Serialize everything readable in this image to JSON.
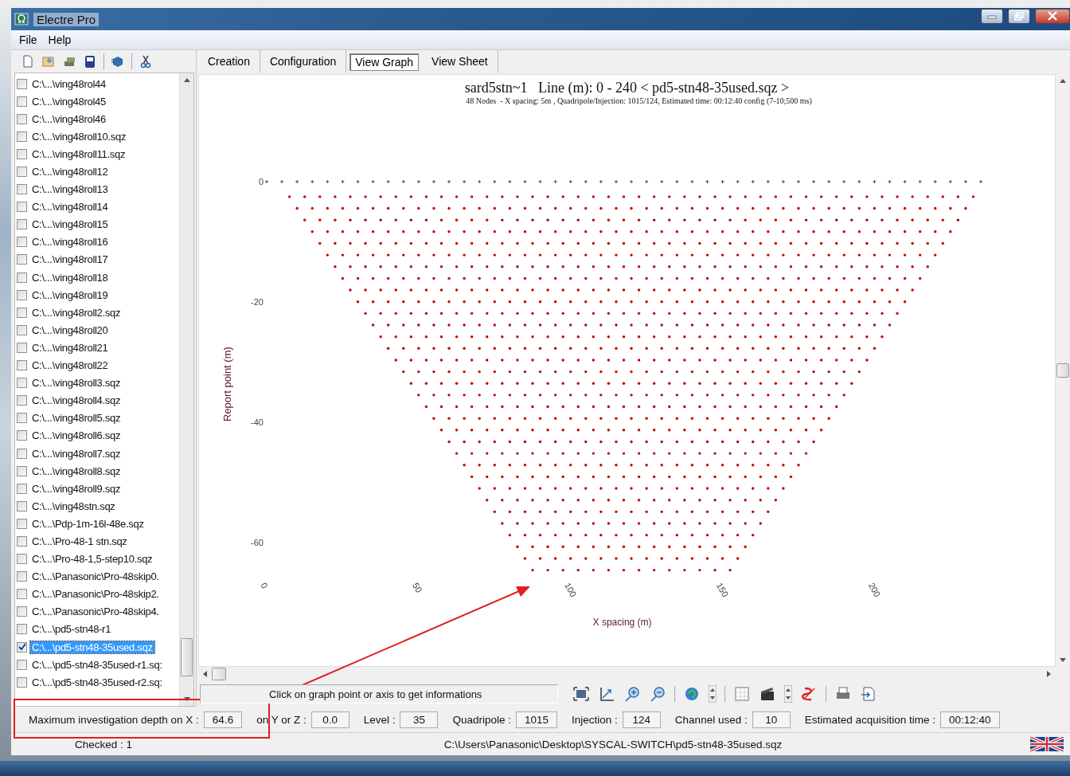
{
  "window": {
    "title": "Electre Pro"
  },
  "menu": [
    "File",
    "Help"
  ],
  "files": [
    {
      "label": "C:\\...\\ving48rol44",
      "checked": false,
      "selected": false
    },
    {
      "label": "C:\\...\\ving48rol45",
      "checked": false,
      "selected": false
    },
    {
      "label": "C:\\...\\ving48rol46",
      "checked": false,
      "selected": false
    },
    {
      "label": "C:\\...\\ving48roll10.sqz",
      "checked": false,
      "selected": false
    },
    {
      "label": "C:\\...\\ving48roll11.sqz",
      "checked": false,
      "selected": false
    },
    {
      "label": "C:\\...\\ving48roll12",
      "checked": false,
      "selected": false
    },
    {
      "label": "C:\\...\\ving48roll13",
      "checked": false,
      "selected": false
    },
    {
      "label": "C:\\...\\ving48roll14",
      "checked": false,
      "selected": false
    },
    {
      "label": "C:\\...\\ving48roll15",
      "checked": false,
      "selected": false
    },
    {
      "label": "C:\\...\\ving48roll16",
      "checked": false,
      "selected": false
    },
    {
      "label": "C:\\...\\ving48roll17",
      "checked": false,
      "selected": false
    },
    {
      "label": "C:\\...\\ving48roll18",
      "checked": false,
      "selected": false
    },
    {
      "label": "C:\\...\\ving48roll19",
      "checked": false,
      "selected": false
    },
    {
      "label": "C:\\...\\ving48roll2.sqz",
      "checked": false,
      "selected": false
    },
    {
      "label": "C:\\...\\ving48roll20",
      "checked": false,
      "selected": false
    },
    {
      "label": "C:\\...\\ving48roll21",
      "checked": false,
      "selected": false
    },
    {
      "label": "C:\\...\\ving48roll22",
      "checked": false,
      "selected": false
    },
    {
      "label": "C:\\...\\ving48roll3.sqz",
      "checked": false,
      "selected": false
    },
    {
      "label": "C:\\...\\ving48roll4.sqz",
      "checked": false,
      "selected": false
    },
    {
      "label": "C:\\...\\ving48roll5.sqz",
      "checked": false,
      "selected": false
    },
    {
      "label": "C:\\...\\ving48roll6.sqz",
      "checked": false,
      "selected": false
    },
    {
      "label": "C:\\...\\ving48roll7.sqz",
      "checked": false,
      "selected": false
    },
    {
      "label": "C:\\...\\ving48roll8.sqz",
      "checked": false,
      "selected": false
    },
    {
      "label": "C:\\...\\ving48roll9.sqz",
      "checked": false,
      "selected": false
    },
    {
      "label": "C:\\...\\ving48stn.sqz",
      "checked": false,
      "selected": false
    },
    {
      "label": "C:\\...\\Pdp-1m-16l-48e.sqz",
      "checked": false,
      "selected": false
    },
    {
      "label": "C:\\...\\Pro-48-1 stn.sqz",
      "checked": false,
      "selected": false
    },
    {
      "label": "C:\\...\\Pro-48-1,5-step10.sqz",
      "checked": false,
      "selected": false
    },
    {
      "label": "C:\\...\\Panasonic\\Pro-48skip0.",
      "checked": false,
      "selected": false
    },
    {
      "label": "C:\\...\\Panasonic\\Pro-48skip2.",
      "checked": false,
      "selected": false
    },
    {
      "label": "C:\\...\\Panasonic\\Pro-48skip4.",
      "checked": false,
      "selected": false
    },
    {
      "label": "C:\\...\\pd5-stn48-r1",
      "checked": false,
      "selected": false
    },
    {
      "label": "C:\\...\\pd5-stn48-35used.sqz",
      "checked": true,
      "selected": true
    },
    {
      "label": "C:\\...\\pd5-stn48-35used-r1.sq:",
      "checked": false,
      "selected": false
    },
    {
      "label": "C:\\...\\pd5-stn48-35used-r2.sq:",
      "checked": false,
      "selected": false
    }
  ],
  "tabs": [
    {
      "label": "Creation",
      "selected": false
    },
    {
      "label": "Configuration",
      "selected": false
    },
    {
      "label": "View Graph",
      "selected": true
    },
    {
      "label": "View Sheet",
      "selected": false
    }
  ],
  "graph": {
    "title": "sard5stn~1   Line (m): 0 - 240 < pd5-stn48-35used.sqz >",
    "subtitle": "48 Nodes  - X spacing: 5m , Quadripole/Injection: 1015/124, Estimated time: 00:12:40 config (7-10;500 ms)",
    "y_axis": {
      "title": "Report point (m)",
      "ticks": [
        "0",
        "-20",
        "-40",
        "-60"
      ]
    },
    "x_axis": {
      "title": "X spacing (m)",
      "ticks": [
        "0",
        "50",
        "100",
        "150",
        "200"
      ]
    }
  },
  "hint": "Click on graph point or axis to get informations",
  "info": [
    {
      "label": "Maximum investigation depth on X :",
      "value": "64.6"
    },
    {
      "label": "on Y or Z :",
      "value": "0.0"
    },
    {
      "label": "Level :",
      "value": "35"
    },
    {
      "label": "Quadripole :",
      "value": "1015"
    },
    {
      "label": "Injection :",
      "value": "124"
    },
    {
      "label": "Channel used :",
      "value": "10"
    },
    {
      "label": "Estimated acquisition time :",
      "value": "00:12:40"
    }
  ],
  "status": {
    "checked": "Checked : 1",
    "path": "C:\\Users\\Panasonic\\Desktop\\SYSCAL-SWITCH\\pd5-stn48-35used.sqz"
  }
}
